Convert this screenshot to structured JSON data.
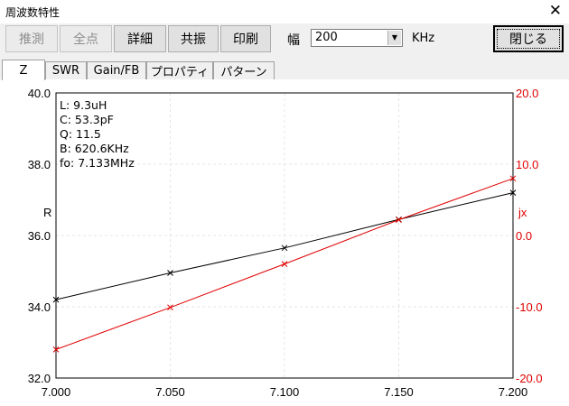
{
  "window": {
    "title": "周波数特性"
  },
  "toolbar": {
    "buttons": [
      {
        "label": "推測"
      },
      {
        "label": "全点"
      },
      {
        "label": "詳細"
      },
      {
        "label": "共振"
      },
      {
        "label": "印刷"
      }
    ],
    "width_label": "幅",
    "width_value": "200",
    "width_unit": "KHz",
    "close_label": "閉じる"
  },
  "tabs": [
    "Z",
    "SWR",
    "Gain/FB",
    "プロパティ",
    "パターン"
  ],
  "info": [
    "L: 9.3uH",
    "C: 53.3pF",
    "Q: 11.5",
    "B: 620.6KHz",
    "fo: 7.133MHz"
  ],
  "colors": {
    "r_series": "#000000",
    "jx_series": "#e00000"
  },
  "chart_data": {
    "type": "line",
    "x": [
      7.0,
      7.05,
      7.1,
      7.15,
      7.2
    ],
    "x_ticks": [
      "7.000",
      "7.050",
      "7.100",
      "7.150",
      "7.200"
    ],
    "xlim": [
      7.0,
      7.2
    ],
    "ylabel_left": "R",
    "ylabel_right": "jx",
    "ylim_left": [
      32,
      40
    ],
    "ylim_right": [
      -20,
      20
    ],
    "y_ticks_left": [
      "32.0",
      "34.0",
      "36.0",
      "38.0",
      "40.0"
    ],
    "y_ticks_right": [
      "-20.0",
      "-10.0",
      "0.0",
      "10.0",
      "20.0"
    ],
    "grid": true,
    "series": [
      {
        "axis": "left",
        "values": [
          34.2,
          34.95,
          35.65,
          36.45,
          37.2
        ]
      },
      {
        "axis": "right",
        "values": [
          -16.0,
          -10.1,
          -4.0,
          2.2,
          8.0
        ]
      }
    ]
  }
}
